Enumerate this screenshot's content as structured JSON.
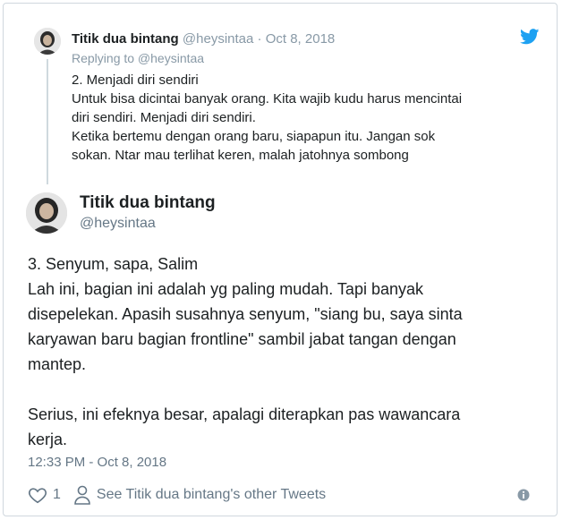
{
  "parent_tweet": {
    "name": "Titik dua bintang",
    "handle": "@heysintaa",
    "separator": "·",
    "date": "Oct 8, 2018",
    "replying_to": "Replying to @heysintaa",
    "lines": [
      "2. Menjadi diri sendiri",
      "Untuk bisa dicintai banyak orang. Kita wajib kudu harus mencintai",
      "diri sendiri. Menjadi diri sendiri.",
      "Ketika bertemu dengan orang baru, siapapun itu. Jangan sok",
      "sokan. Ntar mau terlihat keren, malah jatohnya sombong"
    ]
  },
  "main_tweet": {
    "name": "Titik dua bintang",
    "handle": "@heysintaa",
    "lines": [
      "3. Senyum, sapa, Salim",
      "Lah ini, bagian ini adalah yg paling mudah. Tapi banyak",
      "disepelekan. Apasih susahnya senyum, \"siang bu, saya sinta",
      "karyawan baru bagian frontline\" sambil jabat tangan dengan",
      "mantep.",
      "",
      "Serius, ini efeknya besar, apalagi diterapkan pas wawancara",
      "kerja."
    ],
    "timestamp": "12:33 PM - Oct 8, 2018",
    "like_count": "1",
    "other_tweets_link": "See Titik dua bintang's other Tweets"
  },
  "icons": {
    "brand": "twitter-bird-icon",
    "like": "heart-icon",
    "profile": "person-icon",
    "info": "info-icon"
  },
  "colors": {
    "twitter_blue": "#1da1f2",
    "muted": "#657786",
    "text": "#1c2022"
  }
}
